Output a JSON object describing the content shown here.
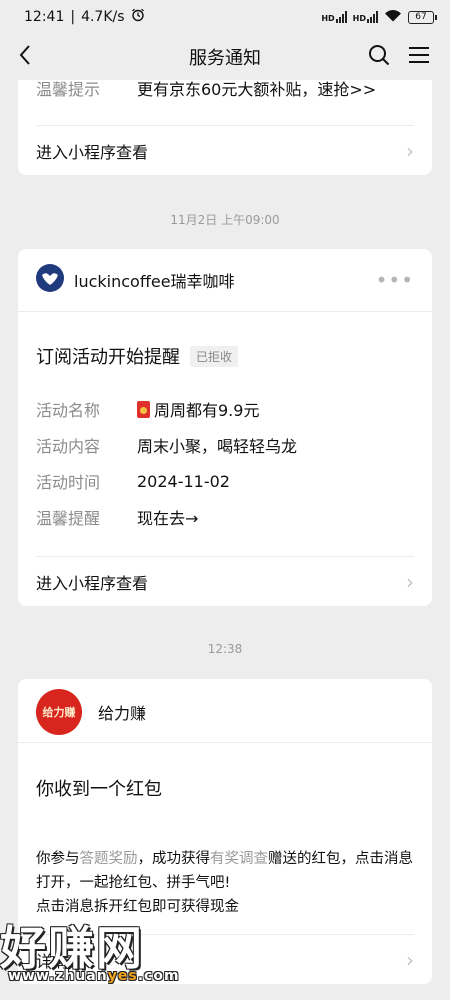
{
  "status_bar": {
    "time": "12:41",
    "net_speed": "4.7K/s",
    "hd_label": "HD",
    "battery": "67"
  },
  "nav": {
    "title": "服务通知"
  },
  "card1": {
    "partial_label": "温馨提示",
    "partial_value": "更有京东60元大额补贴，速抢>>",
    "link": "进入小程序查看"
  },
  "ts1": "11月2日 上午09:00",
  "card2": {
    "brand": "luckincoffee瑞幸咖啡",
    "title": "订阅活动开始提醒",
    "badge": "已拒收",
    "rows": [
      {
        "k": "活动名称",
        "v": "周周都有9.9元"
      },
      {
        "k": "活动内容",
        "v": "周末小聚，喝轻轻乌龙"
      },
      {
        "k": "活动时间",
        "v": "2024-11-02"
      },
      {
        "k": "温馨提醒",
        "v": "现在去→"
      }
    ],
    "link": "进入小程序查看"
  },
  "ts2": "12:38",
  "card3": {
    "logo_text": "给力赚",
    "brand": "给力赚",
    "title": "你收到一个红包",
    "body_p1": "你参与",
    "body_hl1": "答题奖励",
    "body_p2": "，成功获得",
    "body_hl2": "有奖调查",
    "body_p3": "赠送的红包，点击消息打开，一起抢红包、拼手气吧!",
    "body_line2": "点击消息拆开红包即可获得现金",
    "link": "详情"
  },
  "watermark": {
    "big": "好赚网",
    "small_pre": "www.zhuan",
    "small_yes": "yes",
    "small_post": ".com"
  },
  "colors": {
    "background": "#ededed",
    "card": "#ffffff",
    "label_gray": "#8c8c8c",
    "redpack": "#e0302b",
    "luckin_blue": "#1f3a7d"
  }
}
